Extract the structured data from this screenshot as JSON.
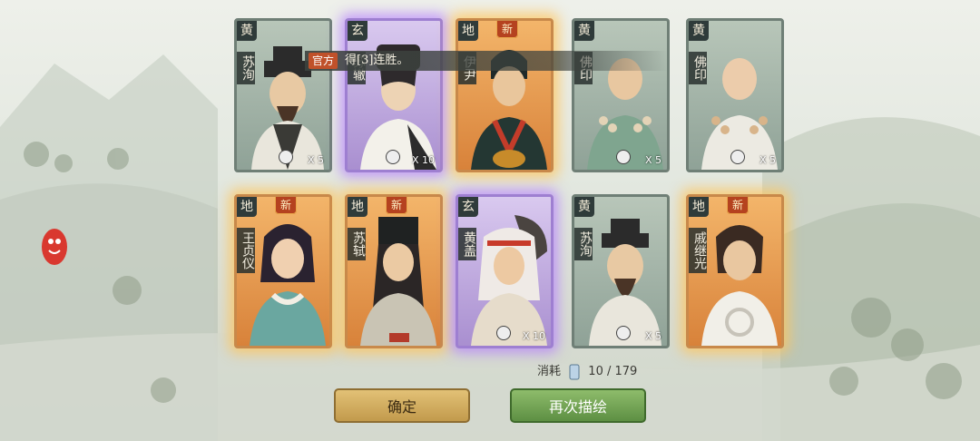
{
  "notice": {
    "tag": "官方",
    "text": "得[3]连胜。"
  },
  "cards": [
    {
      "grade": "黄",
      "name": "苏洵",
      "new": "",
      "count": "X 5",
      "rarity": "huang"
    },
    {
      "grade": "玄",
      "name": "苏辙",
      "new": "",
      "count": "X 10",
      "rarity": "xuan"
    },
    {
      "grade": "地",
      "name": "伊尹",
      "new": "新",
      "count": "",
      "rarity": "di"
    },
    {
      "grade": "黄",
      "name": "佛印",
      "new": "",
      "count": "X 5",
      "rarity": "huang"
    },
    {
      "grade": "黄",
      "name": "佛印",
      "new": "",
      "count": "X 5",
      "rarity": "huang"
    },
    {
      "grade": "地",
      "name": "王贞仪",
      "new": "新",
      "count": "",
      "rarity": "di"
    },
    {
      "grade": "地",
      "name": "苏轼",
      "new": "新",
      "count": "",
      "rarity": "di"
    },
    {
      "grade": "玄",
      "name": "黄盖",
      "new": "",
      "count": "X 10",
      "rarity": "xuan"
    },
    {
      "grade": "黄",
      "name": "苏洵",
      "new": "",
      "count": "X 5",
      "rarity": "huang"
    },
    {
      "grade": "地",
      "name": "戚继光",
      "new": "新",
      "count": "",
      "rarity": "di"
    }
  ],
  "cost": {
    "label": "消耗",
    "current": "10",
    "total": "179",
    "icon": "scroll-icon"
  },
  "buttons": {
    "confirm": "确定",
    "redraw": "再次描绘"
  },
  "colors": {
    "huang": "#8fa297",
    "di": "#d8823a",
    "xuan": "#a98fd0",
    "confirm": "#c29a4c",
    "redraw": "#5d8f43"
  }
}
